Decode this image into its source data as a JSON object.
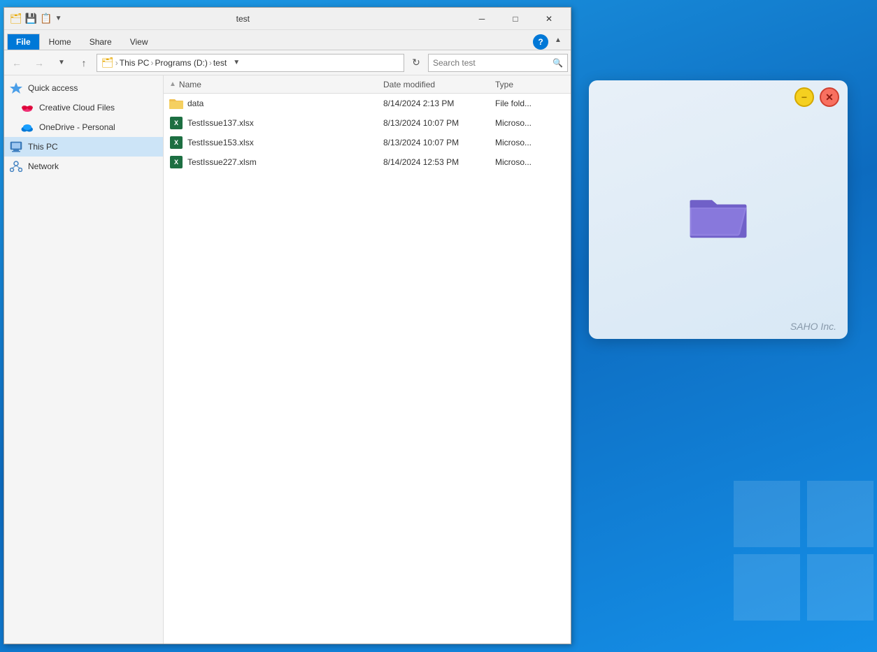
{
  "desktop": {
    "background_color": "#1080d0"
  },
  "explorer": {
    "title": "test",
    "title_bar": {
      "close_label": "✕",
      "minimize_label": "─",
      "maximize_label": "□"
    },
    "ribbon": {
      "tabs": [
        {
          "id": "file",
          "label": "File",
          "active": true
        },
        {
          "id": "home",
          "label": "Home",
          "active": false
        },
        {
          "id": "share",
          "label": "Share",
          "active": false
        },
        {
          "id": "view",
          "label": "View",
          "active": false
        }
      ]
    },
    "address_bar": {
      "back_tooltip": "Back",
      "forward_tooltip": "Forward",
      "up_tooltip": "Up",
      "breadcrumb": [
        {
          "label": "🗂",
          "id": "drive-icon"
        },
        {
          "label": "This PC",
          "id": "this-pc"
        },
        {
          "label": "Programs (D:)",
          "id": "programs-d"
        },
        {
          "label": "test",
          "id": "test-folder"
        }
      ],
      "search_placeholder": "Search test",
      "refresh_tooltip": "Refresh"
    },
    "sidebar": {
      "items": [
        {
          "id": "quick-access",
          "label": "Quick access",
          "icon": "star",
          "selected": false
        },
        {
          "id": "creative-cloud",
          "label": "Creative Cloud Files",
          "icon": "cloud-adobe",
          "selected": false
        },
        {
          "id": "onedrive",
          "label": "OneDrive - Personal",
          "icon": "cloud-onedrive",
          "selected": false
        },
        {
          "id": "this-pc",
          "label": "This PC",
          "icon": "computer",
          "selected": true
        },
        {
          "id": "network",
          "label": "Network",
          "icon": "network",
          "selected": false
        }
      ]
    },
    "columns": {
      "name": "Name",
      "date_modified": "Date modified",
      "type": "Type"
    },
    "files": [
      {
        "id": "data-folder",
        "name": "data",
        "date_modified": "8/14/2024 2:13 PM",
        "type": "File fold...",
        "kind": "folder"
      },
      {
        "id": "testissue137",
        "name": "TestIssue137.xlsx",
        "date_modified": "8/13/2024 10:07 PM",
        "type": "Microso...",
        "kind": "excel"
      },
      {
        "id": "testissue153",
        "name": "TestIssue153.xlsx",
        "date_modified": "8/13/2024 10:07 PM",
        "type": "Microso...",
        "kind": "excel"
      },
      {
        "id": "testissue227",
        "name": "TestIssue227.xlsm",
        "date_modified": "8/14/2024 12:53 PM",
        "type": "Microso...",
        "kind": "excel"
      }
    ]
  },
  "saho_panel": {
    "minimize_label": "−",
    "close_label": "✕",
    "footer_text": "SAHO Inc.",
    "folder_icon_label": "purple folder"
  }
}
